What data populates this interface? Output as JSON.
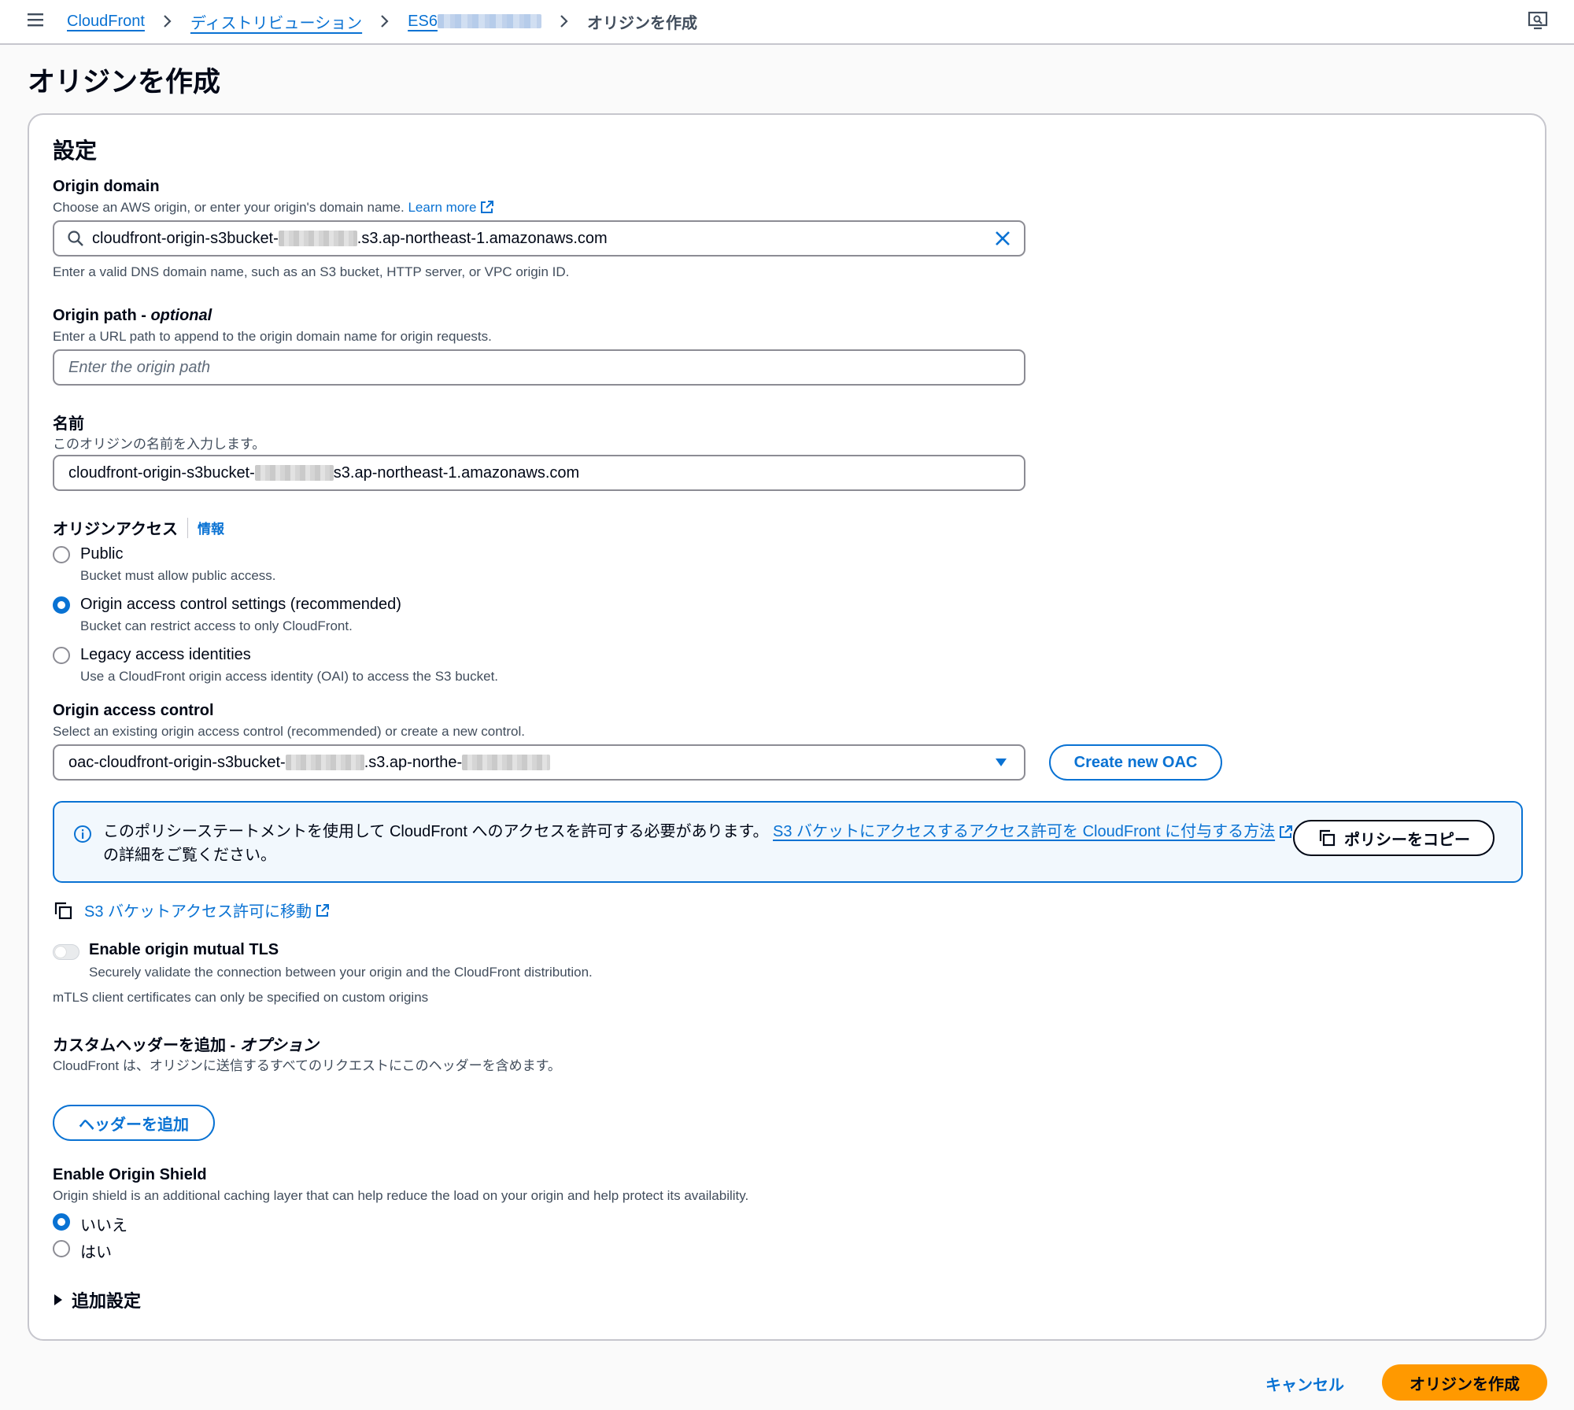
{
  "breadcrumb": {
    "items": [
      "CloudFront",
      "ディストリビューション",
      "ES6"
    ],
    "current": "オリジンを作成"
  },
  "page": {
    "title": "オリジンを作成"
  },
  "section": {
    "title": "設定"
  },
  "origin_domain": {
    "label": "Origin domain",
    "description": "Choose an AWS origin, or enter your origin's domain name.",
    "learn_more": "Learn more",
    "value_prefix": "cloudfront-origin-s3bucket-",
    "value_suffix": ".s3.ap-northeast-1.amazonaws.com",
    "help": "Enter a valid DNS domain name, such as an S3 bucket, HTTP server, or VPC origin ID."
  },
  "origin_path": {
    "label": "Origin path - ",
    "label_optional": "optional",
    "description": "Enter a URL path to append to the origin domain name for origin requests.",
    "placeholder": "Enter the origin path"
  },
  "name": {
    "label": "名前",
    "description": "このオリジンの名前を入力します。",
    "value_prefix": "cloudfront-origin-s3bucket-",
    "value_suffix": "s3.ap-northeast-1.amazonaws.com"
  },
  "origin_access": {
    "label": "オリジンアクセス",
    "info": "情報",
    "options": [
      {
        "label": "Public",
        "description": "Bucket must allow public access.",
        "checked": false
      },
      {
        "label": "Origin access control settings (recommended)",
        "description": "Bucket can restrict access to only CloudFront.",
        "checked": true
      },
      {
        "label": "Legacy access identities",
        "description": "Use a CloudFront origin access identity (OAI) to access the S3 bucket.",
        "checked": false
      }
    ]
  },
  "oac": {
    "label": "Origin access control",
    "description": "Select an existing origin access control (recommended) or create a new control.",
    "value_prefix": "oac-cloudfront-origin-s3bucket-",
    "value_suffix": ".s3.ap-northe-",
    "create_button": "Create new OAC"
  },
  "info_alert": {
    "text_before": "このポリシーステートメントを使用して CloudFront へのアクセスを許可する必要があります。",
    "link_text": "S3 バケットにアクセスするアクセス許可を CloudFront に付与する方法",
    "text_after": "の詳細をご覧ください。",
    "copy_button": "ポリシーをコピー"
  },
  "s3_link": {
    "label": "S3 バケットアクセス許可に移動"
  },
  "mtls": {
    "label": "Enable origin mutual TLS",
    "description": "Securely validate the connection between your origin and the CloudFront distribution.",
    "note": "mTLS client certificates can only be specified on custom origins",
    "enabled": false
  },
  "custom_headers": {
    "label": "カスタムヘッダーを追加 - ",
    "label_optional": "オプション",
    "description": "CloudFront は、オリジンに送信するすべてのリクエストにこのヘッダーを含めます。",
    "add_button": "ヘッダーを追加"
  },
  "origin_shield": {
    "label": "Enable Origin Shield",
    "description": "Origin shield is an additional caching layer that can help reduce the load on your origin and help protect its availability.",
    "options": [
      {
        "label": "いいえ",
        "checked": true
      },
      {
        "label": "はい",
        "checked": false
      }
    ]
  },
  "additional_settings": {
    "label": "追加設定"
  },
  "footer": {
    "cancel": "キャンセル",
    "submit": "オリジンを作成"
  },
  "colors": {
    "accent": "#0972d3",
    "primary_button": "#ff9900",
    "border": "#8c8c94",
    "text": "#000716"
  }
}
